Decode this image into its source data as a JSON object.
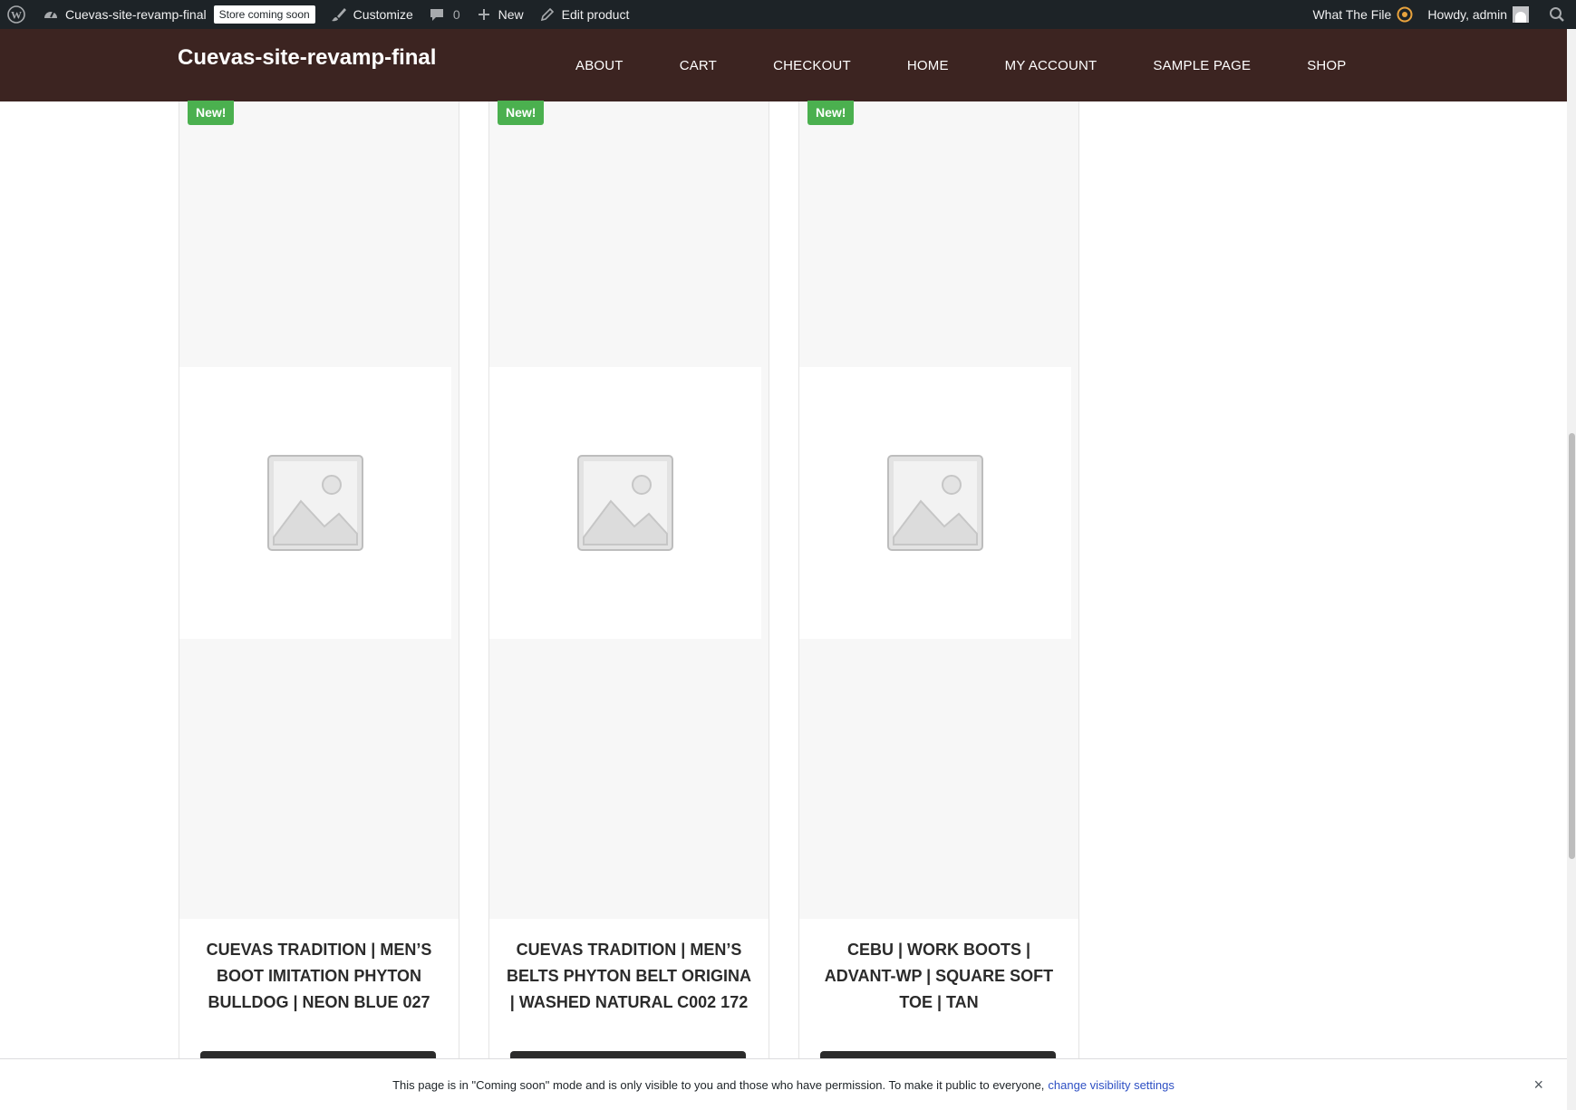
{
  "admin_bar": {
    "site_name": "Cuevas-site-revamp-final",
    "store_badge": "Store coming soon",
    "customize": "Customize",
    "comments_count": "0",
    "new": "New",
    "edit_product": "Edit product",
    "plugin": "What The File",
    "greeting": "Howdy, admin"
  },
  "header": {
    "site_title": "Cuevas-site-revamp-final",
    "nav": [
      "ABOUT",
      "CART",
      "CHECKOUT",
      "HOME",
      "MY ACCOUNT",
      "SAMPLE PAGE",
      "SHOP"
    ]
  },
  "products": [
    {
      "badge": "New!",
      "title": "CUEVAS TRADITION | MEN’S BOOT IMITATION PHYTON BULLDOG | NEON BLUE 027"
    },
    {
      "badge": "New!",
      "title": "CUEVAS TRADITION | MEN’S BELTS PHYTON BELT ORIGINA | WASHED NATURAL C002 172"
    },
    {
      "badge": "New!",
      "title": "CEBU | WORK BOOTS | ADVANT-WP | SQUARE SOFT TOE | TAN"
    }
  ],
  "notice": {
    "text": "This page is in \"Coming soon\" mode and is only visible to you and those who have permission. To make it public to everyone,",
    "link": "change visibility settings",
    "close": "×"
  },
  "colors": {
    "admin_bar": "#1d2327",
    "header": "#3c2421",
    "badge": "#4bb04f",
    "link": "#2e50c4"
  }
}
